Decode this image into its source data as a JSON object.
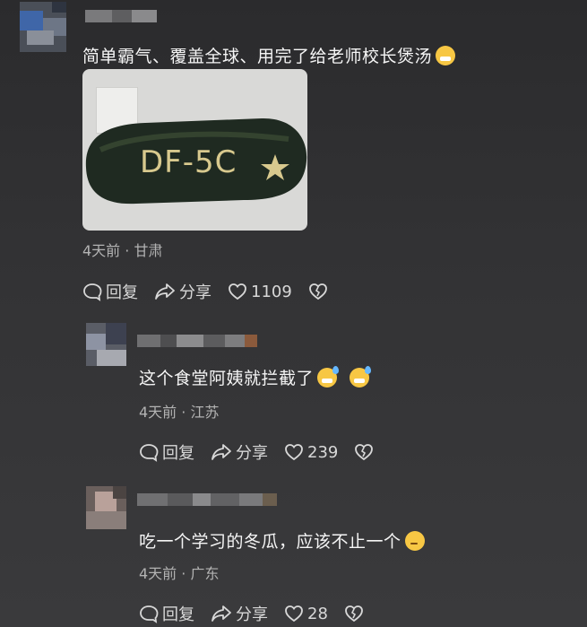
{
  "comments": [
    {
      "text": "简单霸气、覆盖全球、用完了给老师校长煲汤",
      "emojis": [
        "grin-icon"
      ],
      "image_label": "DF-5C",
      "meta": "4天前 · 甘肃",
      "reply": "回复",
      "share": "分享",
      "likes": "1109"
    },
    {
      "text": "这个食堂阿姨就拦截了",
      "emojis": [
        "sweat-smile-icon",
        "sweat-smile-icon"
      ],
      "meta": "4天前 · 江苏",
      "reply": "回复",
      "share": "分享",
      "likes": "239"
    },
    {
      "text": "吃一个学习的冬瓜，应该不止一个",
      "emojis": [
        "thinking-icon"
      ],
      "meta": "4天前 · 广东",
      "reply": "回复",
      "share": "分享",
      "likes": "28"
    }
  ],
  "colors": {
    "background": "#333335",
    "meta": "#b3b3b3",
    "text": "#f5f5f5"
  }
}
